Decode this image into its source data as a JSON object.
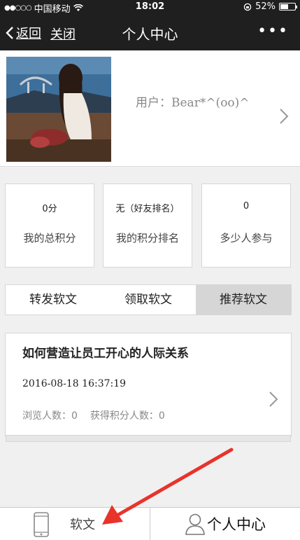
{
  "status": {
    "carrier": "中国移动",
    "time": "18:02",
    "battery": "52%"
  },
  "nav": {
    "back": "返回",
    "close": "关闭",
    "title": "个人中心"
  },
  "profile": {
    "user_label": "用户：",
    "user_name": "Bear*^(oo)^"
  },
  "stats": [
    {
      "value": "0分",
      "label": "我的总积分"
    },
    {
      "value": "无（好友排名）",
      "label": "我的积分排名"
    },
    {
      "value": "0",
      "label": "多少人参与"
    }
  ],
  "tabs": [
    {
      "label": "转发软文",
      "active": false
    },
    {
      "label": "领取软文",
      "active": false
    },
    {
      "label": "推荐软文",
      "active": true
    }
  ],
  "article": {
    "title": "如何营造让员工开心的人际关系",
    "date": "2016-08-18 16:37:19",
    "views": "浏览人数：0",
    "points": "获得积分人数：0"
  },
  "footer": {
    "wen": "软文",
    "me": "个人中心"
  },
  "colors": {
    "bar": "#1f1f1f",
    "active_tab": "#d6d6d6",
    "arrow": "#e8332b"
  }
}
